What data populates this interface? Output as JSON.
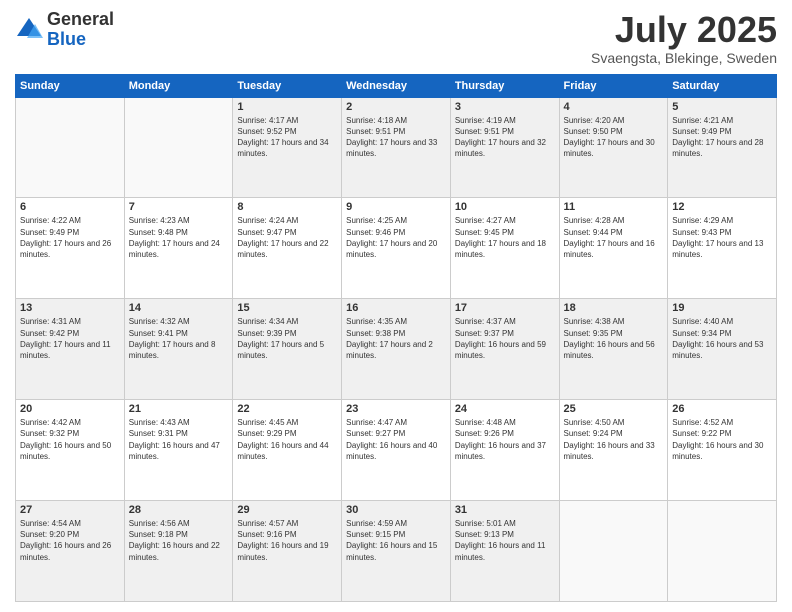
{
  "logo": {
    "general": "General",
    "blue": "Blue"
  },
  "title": "July 2025",
  "location": "Svaengsta, Blekinge, Sweden",
  "days_of_week": [
    "Sunday",
    "Monday",
    "Tuesday",
    "Wednesday",
    "Thursday",
    "Friday",
    "Saturday"
  ],
  "weeks": [
    [
      {
        "day": "",
        "info": ""
      },
      {
        "day": "",
        "info": ""
      },
      {
        "day": "1",
        "info": "Sunrise: 4:17 AM\nSunset: 9:52 PM\nDaylight: 17 hours and 34 minutes."
      },
      {
        "day": "2",
        "info": "Sunrise: 4:18 AM\nSunset: 9:51 PM\nDaylight: 17 hours and 33 minutes."
      },
      {
        "day": "3",
        "info": "Sunrise: 4:19 AM\nSunset: 9:51 PM\nDaylight: 17 hours and 32 minutes."
      },
      {
        "day": "4",
        "info": "Sunrise: 4:20 AM\nSunset: 9:50 PM\nDaylight: 17 hours and 30 minutes."
      },
      {
        "day": "5",
        "info": "Sunrise: 4:21 AM\nSunset: 9:49 PM\nDaylight: 17 hours and 28 minutes."
      }
    ],
    [
      {
        "day": "6",
        "info": "Sunrise: 4:22 AM\nSunset: 9:49 PM\nDaylight: 17 hours and 26 minutes."
      },
      {
        "day": "7",
        "info": "Sunrise: 4:23 AM\nSunset: 9:48 PM\nDaylight: 17 hours and 24 minutes."
      },
      {
        "day": "8",
        "info": "Sunrise: 4:24 AM\nSunset: 9:47 PM\nDaylight: 17 hours and 22 minutes."
      },
      {
        "day": "9",
        "info": "Sunrise: 4:25 AM\nSunset: 9:46 PM\nDaylight: 17 hours and 20 minutes."
      },
      {
        "day": "10",
        "info": "Sunrise: 4:27 AM\nSunset: 9:45 PM\nDaylight: 17 hours and 18 minutes."
      },
      {
        "day": "11",
        "info": "Sunrise: 4:28 AM\nSunset: 9:44 PM\nDaylight: 17 hours and 16 minutes."
      },
      {
        "day": "12",
        "info": "Sunrise: 4:29 AM\nSunset: 9:43 PM\nDaylight: 17 hours and 13 minutes."
      }
    ],
    [
      {
        "day": "13",
        "info": "Sunrise: 4:31 AM\nSunset: 9:42 PM\nDaylight: 17 hours and 11 minutes."
      },
      {
        "day": "14",
        "info": "Sunrise: 4:32 AM\nSunset: 9:41 PM\nDaylight: 17 hours and 8 minutes."
      },
      {
        "day": "15",
        "info": "Sunrise: 4:34 AM\nSunset: 9:39 PM\nDaylight: 17 hours and 5 minutes."
      },
      {
        "day": "16",
        "info": "Sunrise: 4:35 AM\nSunset: 9:38 PM\nDaylight: 17 hours and 2 minutes."
      },
      {
        "day": "17",
        "info": "Sunrise: 4:37 AM\nSunset: 9:37 PM\nDaylight: 16 hours and 59 minutes."
      },
      {
        "day": "18",
        "info": "Sunrise: 4:38 AM\nSunset: 9:35 PM\nDaylight: 16 hours and 56 minutes."
      },
      {
        "day": "19",
        "info": "Sunrise: 4:40 AM\nSunset: 9:34 PM\nDaylight: 16 hours and 53 minutes."
      }
    ],
    [
      {
        "day": "20",
        "info": "Sunrise: 4:42 AM\nSunset: 9:32 PM\nDaylight: 16 hours and 50 minutes."
      },
      {
        "day": "21",
        "info": "Sunrise: 4:43 AM\nSunset: 9:31 PM\nDaylight: 16 hours and 47 minutes."
      },
      {
        "day": "22",
        "info": "Sunrise: 4:45 AM\nSunset: 9:29 PM\nDaylight: 16 hours and 44 minutes."
      },
      {
        "day": "23",
        "info": "Sunrise: 4:47 AM\nSunset: 9:27 PM\nDaylight: 16 hours and 40 minutes."
      },
      {
        "day": "24",
        "info": "Sunrise: 4:48 AM\nSunset: 9:26 PM\nDaylight: 16 hours and 37 minutes."
      },
      {
        "day": "25",
        "info": "Sunrise: 4:50 AM\nSunset: 9:24 PM\nDaylight: 16 hours and 33 minutes."
      },
      {
        "day": "26",
        "info": "Sunrise: 4:52 AM\nSunset: 9:22 PM\nDaylight: 16 hours and 30 minutes."
      }
    ],
    [
      {
        "day": "27",
        "info": "Sunrise: 4:54 AM\nSunset: 9:20 PM\nDaylight: 16 hours and 26 minutes."
      },
      {
        "day": "28",
        "info": "Sunrise: 4:56 AM\nSunset: 9:18 PM\nDaylight: 16 hours and 22 minutes."
      },
      {
        "day": "29",
        "info": "Sunrise: 4:57 AM\nSunset: 9:16 PM\nDaylight: 16 hours and 19 minutes."
      },
      {
        "day": "30",
        "info": "Sunrise: 4:59 AM\nSunset: 9:15 PM\nDaylight: 16 hours and 15 minutes."
      },
      {
        "day": "31",
        "info": "Sunrise: 5:01 AM\nSunset: 9:13 PM\nDaylight: 16 hours and 11 minutes."
      },
      {
        "day": "",
        "info": ""
      },
      {
        "day": "",
        "info": ""
      }
    ]
  ]
}
